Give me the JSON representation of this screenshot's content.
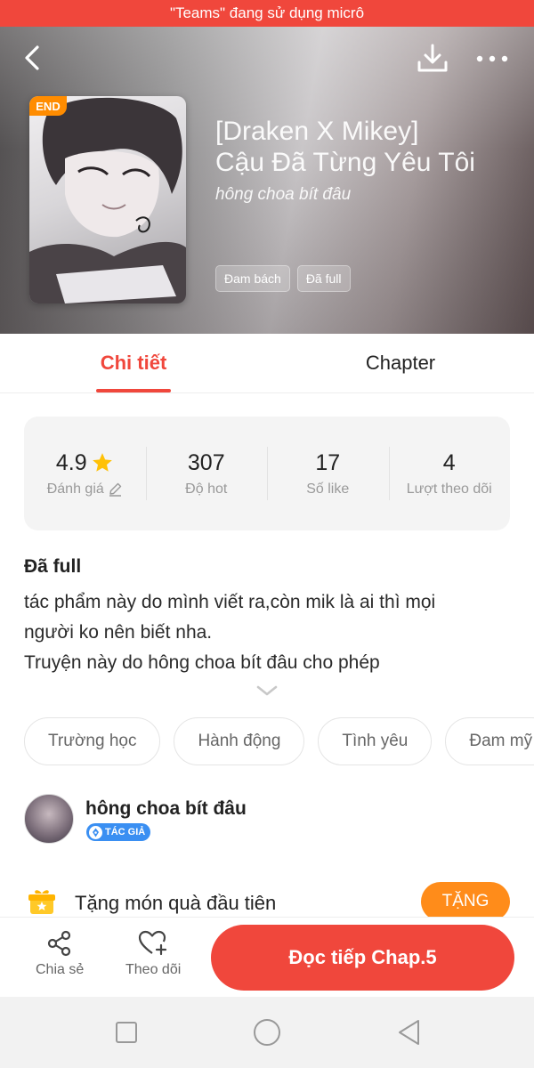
{
  "status_bar": {
    "mic_text": "\"Teams\" đang sử dụng micrô"
  },
  "header": {
    "back_icon": "chevron-left-icon",
    "download_icon": "download-icon",
    "more_icon": "more-horizontal-icon"
  },
  "story": {
    "badge": "END",
    "title_line1": "[Draken X Mikey]",
    "title_line2": "Cậu Đã Từng Yêu Tôi",
    "author": "hông choa bít đâu",
    "tags": [
      "Đam bách",
      "Đã full"
    ]
  },
  "tabs": [
    {
      "label": "Chi tiết",
      "active": true
    },
    {
      "label": "Chapter",
      "active": false
    }
  ],
  "stats": [
    {
      "value": "4.9",
      "label": "Đánh giá"
    },
    {
      "value": "307",
      "label": "Độ hot"
    },
    {
      "value": "17",
      "label": "Số like"
    },
    {
      "value": "4",
      "label": "Lượt theo dõi"
    }
  ],
  "description": {
    "status": "Đã full",
    "lines": [
      "tác phẩm này do mình viết ra,còn mik là ai thì mọi",
      "người ko nên biết nha.",
      "Truyện này do hông choa bít đâu cho phép"
    ]
  },
  "categories": [
    "Trường học",
    "Hành động",
    "Tình yêu",
    "Đam mỹ"
  ],
  "author_section": {
    "name": "hông choa bít đâu",
    "badge": "TÁC GIẢ"
  },
  "gift": {
    "text": "Tặng món quà đầu tiên",
    "button": "TẶNG"
  },
  "bottom_bar": {
    "share_label": "Chia sẻ",
    "follow_label": "Theo dõi",
    "read_button": "Đọc tiếp Chap.5"
  },
  "colors": {
    "accent": "#f0473c",
    "orange": "#ff8c1a",
    "star": "#ffc107",
    "badge_blue": "#3a8ff2"
  }
}
